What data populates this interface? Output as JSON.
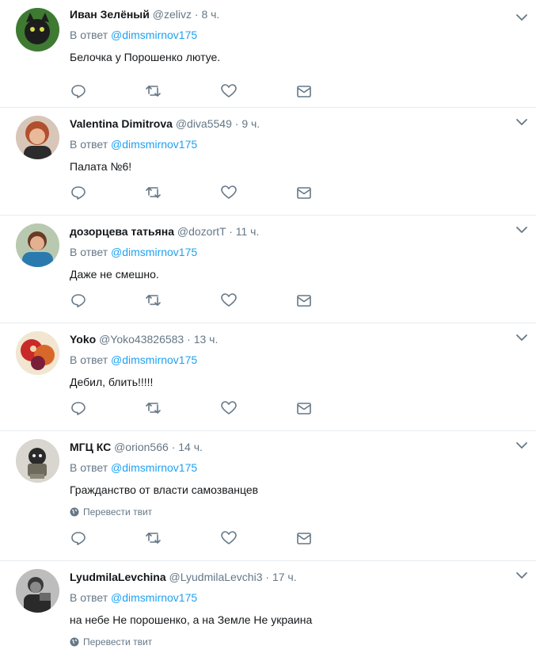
{
  "reply_prefix": "В ответ",
  "translate_label": "Перевести твит",
  "colors": {
    "accent": "#1da1f2",
    "muted": "#657786",
    "divider": "#e6ecf0"
  },
  "tweets": [
    {
      "fullname": "Иван Зелёный",
      "username": "@zelivz",
      "time": "8 ч.",
      "reply_to": "@dimsmirnov175",
      "text": "Белочка у Порошенко лютуе.",
      "translate": false,
      "avatar_color": "#2f5f2a"
    },
    {
      "fullname": "Valentina Dimitrova",
      "username": "@diva5549",
      "time": "9 ч.",
      "reply_to": "@dimsmirnov175",
      "text": "Палата №6!",
      "translate": false,
      "avatar_color": "#c98a6a"
    },
    {
      "fullname": "дозорцева татьяна",
      "username": "@dozortT",
      "time": "11 ч.",
      "reply_to": "@dimsmirnov175",
      "text": "Даже не смешно.",
      "translate": false,
      "avatar_color": "#5f8fb0"
    },
    {
      "fullname": "Yoko",
      "username": "@Yoko43826583",
      "time": "13 ч.",
      "reply_to": "@dimsmirnov175",
      "text": "Дебил, блить!!!!!",
      "translate": false,
      "avatar_color": "#c82a2a"
    },
    {
      "fullname": "МГЦ КС",
      "username": "@orion566",
      "time": "14 ч.",
      "reply_to": "@dimsmirnov175",
      "text": "Гражданство от власти самозванцев",
      "translate": true,
      "avatar_color": "#6e6a5c"
    },
    {
      "fullname": "LyudmilaLevchina",
      "username": "@LyudmilaLevchi3",
      "time": "17 ч.",
      "reply_to": "@dimsmirnov175",
      "text": "на небе Не порошенко, а на Земле Не украина",
      "translate": true,
      "avatar_color": "#3a3a3a"
    }
  ]
}
